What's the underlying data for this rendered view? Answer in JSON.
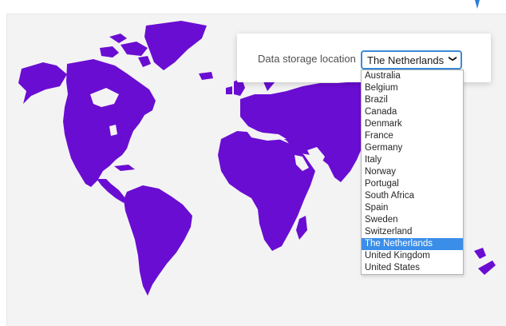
{
  "colors": {
    "map_fill": "#6a0dd2",
    "panel_background": "#f3f3f4",
    "accent": "#3b8ee8"
  },
  "map": {
    "icon": "world-map"
  },
  "storage": {
    "label": "Data storage location",
    "selected": "The Netherlands",
    "chevron_icon": "chevron-down",
    "options": [
      "Australia",
      "Belgium",
      "Brazil",
      "Canada",
      "Denmark",
      "France",
      "Germany",
      "Italy",
      "Norway",
      "Portugal",
      "South Africa",
      "Spain",
      "Sweden",
      "Switzerland",
      "The Netherlands",
      "United Kingdom",
      "United States"
    ]
  }
}
